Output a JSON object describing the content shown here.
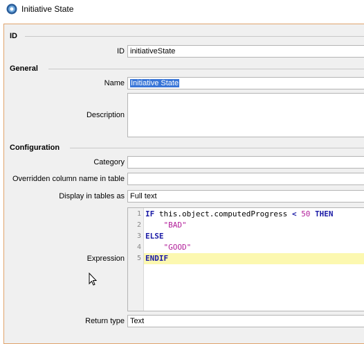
{
  "window": {
    "title": "Initiative State",
    "icon": "app-icon"
  },
  "sections": {
    "id": "ID",
    "general": "General",
    "configuration": "Configuration"
  },
  "fields": {
    "id": {
      "label": "ID",
      "value": "initiativeState"
    },
    "name": {
      "label": "Name",
      "value": "Initiative State"
    },
    "description": {
      "label": "Description",
      "value": ""
    },
    "category": {
      "label": "Category",
      "value": ""
    },
    "overridden_column_name": {
      "label": "Overridden column name in table",
      "value": ""
    },
    "display_in_tables_as": {
      "label": "Display in tables as",
      "value": "Full text"
    },
    "expression": {
      "label": "Expression"
    },
    "return_type": {
      "label": "Return type",
      "value": "Text"
    }
  },
  "expression_lines": [
    {
      "num": "1",
      "kw1": "IF",
      "text": " this.object.computedProgress ",
      "op": "<",
      "sp": " ",
      "numval": "50",
      "sp2": " ",
      "kw2": "THEN"
    },
    {
      "num": "2",
      "indent": "    ",
      "str": "\"BAD\""
    },
    {
      "num": "3",
      "kw1": "ELSE"
    },
    {
      "num": "4",
      "indent": "    ",
      "str": "\"GOOD\""
    },
    {
      "num": "5",
      "kw1": "ENDIF"
    }
  ],
  "colors": {
    "accent_border": "#e0a36b",
    "selection": "#3875d7",
    "keyword": "#1a1aa6",
    "string": "#b21f9a",
    "current_line": "#fcf8b0"
  }
}
